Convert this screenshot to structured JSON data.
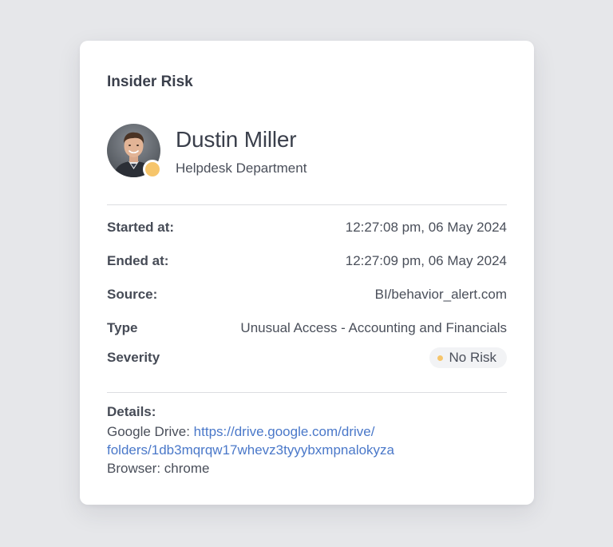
{
  "card": {
    "title": "Insider Risk"
  },
  "user": {
    "name": "Dustin Miller",
    "department": "Helpdesk Department",
    "status_color": "#f6c56b"
  },
  "fields": [
    {
      "label": "Started at:",
      "value": "12:27:08 pm, 06 May 2024"
    },
    {
      "label": "Ended at:",
      "value": "12:27:09 pm, 06 May 2024"
    },
    {
      "label": "Source:",
      "value": "BI/behavior_alert.com"
    },
    {
      "label": "Type",
      "value": "Unusual Access - Accounting and Financials"
    }
  ],
  "severity": {
    "label": "Severity",
    "value": "No Risk",
    "color": "#f6c56b"
  },
  "details": {
    "label": "Details:",
    "drive_prefix": "Google Drive: ",
    "drive_link_line1": "https://drive.google.com/drive/",
    "drive_link_line2": "folders/1db3mqrqw17whevz3tyyybxmpnalokyza",
    "browser": "Browser: chrome"
  },
  "colors": {
    "link": "#4a78c9",
    "text": "#4a4f5a",
    "heading": "#3a3f4b"
  }
}
